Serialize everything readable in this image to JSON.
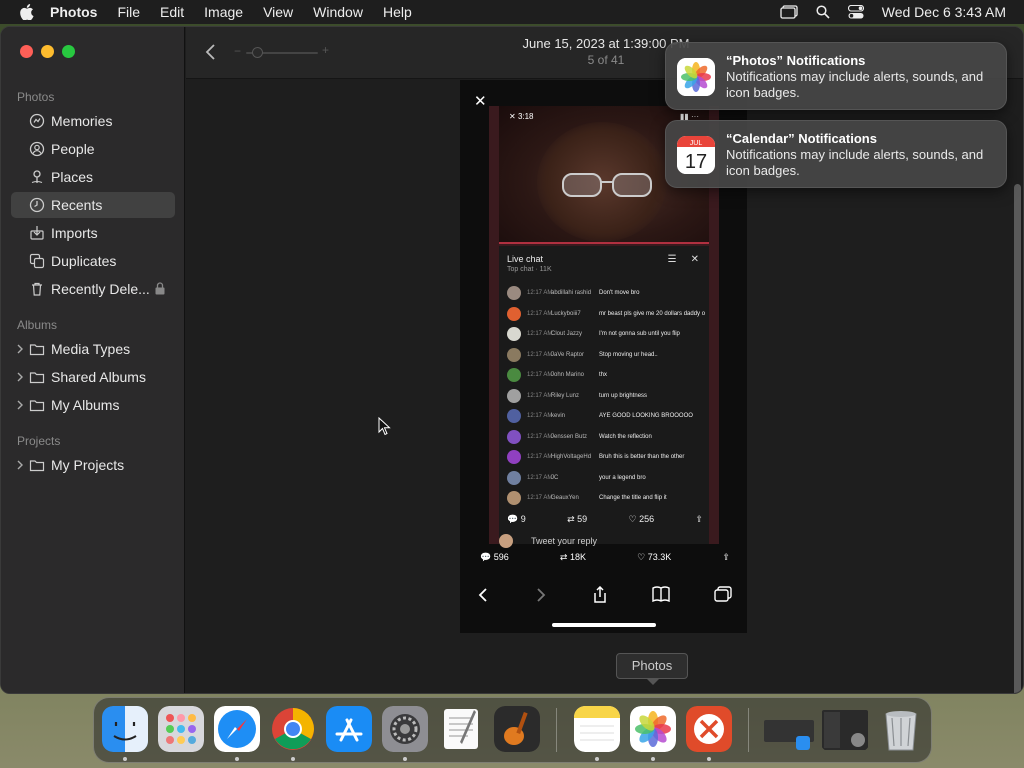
{
  "menubar": {
    "app": "Photos",
    "items": [
      "File",
      "Edit",
      "Image",
      "View",
      "Window",
      "Help"
    ],
    "clock": "Wed Dec 6  3:43 AM"
  },
  "sidebar": {
    "section_photos": "Photos",
    "items": [
      "Memories",
      "People",
      "Places",
      "Recents",
      "Imports",
      "Duplicates",
      "Recently Dele..."
    ],
    "selected": "Recents",
    "section_albums": "Albums",
    "albums": [
      "Media Types",
      "Shared Albums",
      "My Albums"
    ],
    "section_projects": "Projects",
    "projects": [
      "My Projects"
    ]
  },
  "toolbar": {
    "title": "June 15, 2023 at 1:39:00 PM",
    "subtitle": "5 of 41"
  },
  "photo": {
    "status_time": "3:18",
    "chat_title": "Live chat",
    "chat_sub": "Top chat  ·  11K",
    "messages": [
      {
        "time": "12:17 AM",
        "name": "abdillahi rashid",
        "text": "Don't move bro",
        "color": "#9a8a80"
      },
      {
        "time": "12:17 AM",
        "name": "Luckyboiii7",
        "text": "mr beast pls give me 20 dollars daddy o",
        "color": "#e06030"
      },
      {
        "time": "12:17 AM",
        "name": "Clout Jazzy",
        "text": "I'm not gonna sub until you flip",
        "color": "#d8d8d0"
      },
      {
        "time": "12:17 AM",
        "name": "JaVe Raptor",
        "text": "Stop moving ur head..",
        "color": "#8a7a60"
      },
      {
        "time": "12:17 AM",
        "name": "John Marino",
        "text": "thx",
        "color": "#4a8a40"
      },
      {
        "time": "12:17 AM",
        "name": "Riley Lunz",
        "text": "turn up brightness",
        "color": "#a0a0a0"
      },
      {
        "time": "12:17 AM",
        "name": "kevin",
        "text": "AYE GOOD LOOKING BROOOOO",
        "color": "#5060a0"
      },
      {
        "time": "12:17 AM",
        "name": "Jenssen Butz",
        "text": "Watch the reflection",
        "color": "#8050c0"
      },
      {
        "time": "12:17 AM",
        "name": "HighVoltageHd",
        "text": "Bruh this is better than the other",
        "color": "#9040c0"
      },
      {
        "time": "12:17 AM",
        "name": "JC",
        "text": "your a legend bro",
        "color": "#7080a0"
      },
      {
        "time": "12:17 AM",
        "name": "GeauxYen",
        "text": "Change the title and flip it",
        "color": "#b09070"
      }
    ],
    "inner_replies": "9",
    "inner_retweets": "59",
    "inner_likes": "256",
    "reply_placeholder": "Tweet your reply",
    "replies": "596",
    "retweets": "18K",
    "likes": "73.3K"
  },
  "notifications": [
    {
      "title": "“Photos” Notifications",
      "body": "Notifications may include alerts, sounds, and icon badges."
    },
    {
      "title": "“Calendar” Notifications",
      "body": "Notifications may include alerts, sounds, and icon badges.",
      "cal_month": "JUL",
      "cal_day": "17"
    }
  ],
  "tooltip": "Photos",
  "dock": [
    "Finder",
    "Launchpad",
    "Safari",
    "Chrome",
    "App Store",
    "System Settings",
    "TextEdit",
    "GarageBand",
    "Notes",
    "Photos",
    "Remote Desktop",
    "Window Preview",
    "Window Preview 2",
    "Trash"
  ]
}
